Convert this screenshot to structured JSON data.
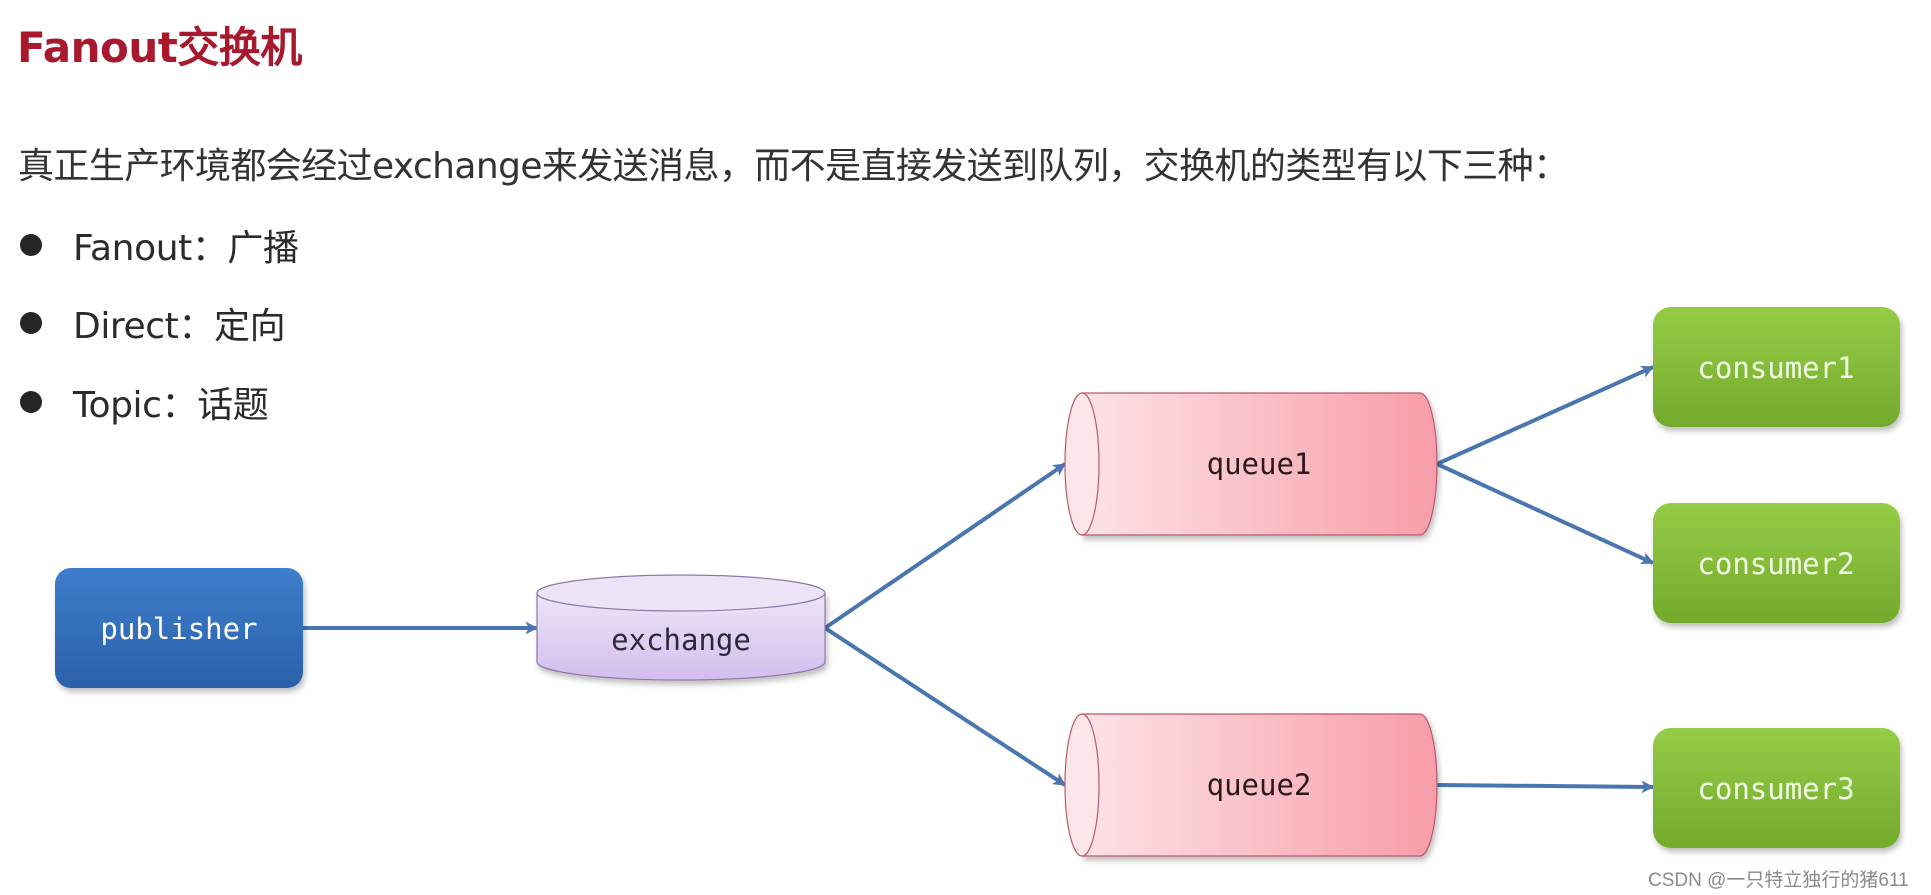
{
  "slide": {
    "title": "Fanout交换机",
    "intro": "真正生产环境都会经过exchange来发送消息，而不是直接发送到队列，交换机的类型有以下三种：",
    "exchange_types": [
      {
        "name": "Fanout",
        "separator": "：",
        "meaning": "广播",
        "label": "Fanout：广播"
      },
      {
        "name": "Direct",
        "separator": "：",
        "meaning": "定向",
        "label": "Direct：定向"
      },
      {
        "name": "Topic",
        "separator": "：",
        "meaning": "话题",
        "label": "Topic：话题"
      }
    ]
  },
  "diagram": {
    "nodes": {
      "publisher": {
        "label": "publisher",
        "shape": "rounded-rect",
        "color": "#3470bb"
      },
      "exchange": {
        "label": "exchange",
        "shape": "cylinder",
        "color": "#dccbf2"
      },
      "queue1": {
        "label": "queue1",
        "shape": "horizontal-cylinder",
        "color": "#f9b3bd"
      },
      "queue2": {
        "label": "queue2",
        "shape": "horizontal-cylinder",
        "color": "#f9b3bd"
      },
      "consumer1": {
        "label": "consumer1",
        "shape": "rounded-rect",
        "color": "#86c03a"
      },
      "consumer2": {
        "label": "consumer2",
        "shape": "rounded-rect",
        "color": "#86c03a"
      },
      "consumer3": {
        "label": "consumer3",
        "shape": "rounded-rect",
        "color": "#86c03a"
      }
    },
    "edges": [
      {
        "from": "publisher",
        "to": "exchange"
      },
      {
        "from": "exchange",
        "to": "queue1"
      },
      {
        "from": "exchange",
        "to": "queue2"
      },
      {
        "from": "queue1",
        "to": "consumer1"
      },
      {
        "from": "queue1",
        "to": "consumer2"
      },
      {
        "from": "queue2",
        "to": "consumer3"
      }
    ],
    "edge_color": "#4a76b0"
  },
  "watermark": "CSDN @一只特立独行的猪611"
}
